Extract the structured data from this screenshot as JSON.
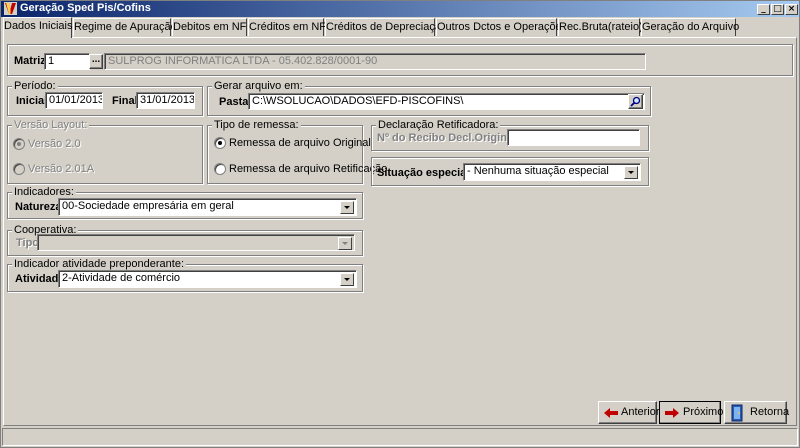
{
  "window": {
    "title": "Geração Sped Pis/Cofins",
    "controls": {
      "minimize": "_",
      "maximize": "□",
      "close": "×"
    }
  },
  "tabs": [
    "Dados Iniciais",
    "Regime de Apuração",
    "Debitos em NF",
    "Créditos em NF",
    "Créditos de Depreciação",
    "Outros Dctos e Operações",
    "Rec.Bruta(rateio)",
    "Geração do Arquivo"
  ],
  "matriz": {
    "label": "Matriz",
    "value": "1",
    "lookup_label": "...",
    "company": "SULPROG INFORMATICA LTDA - 05.402.828/0001-90"
  },
  "periodo": {
    "legend": "Período:",
    "inicial_label": "Inicial",
    "inicial_value": "01/01/2013",
    "final_label": "Final",
    "final_value": "31/01/2013"
  },
  "gerar": {
    "legend": "Gerar arquivo em:",
    "pasta_label": "Pasta",
    "pasta_value": "C:\\WSOLUCAO\\DADOS\\EFD-PISCOFINS\\"
  },
  "versao": {
    "legend": "Versão Layout:",
    "options": [
      "Versão 2.0",
      "Versão 2.01A"
    ]
  },
  "remessa": {
    "legend": "Tipo de remessa:",
    "options": [
      "Remessa de arquivo Original",
      "Remessa de arquivo Retificação"
    ]
  },
  "retificadora": {
    "legend": "Declaração Retificadora:",
    "recibo_label": "Nº do Recibo Decl.Original:",
    "recibo_value": ""
  },
  "situacao": {
    "label": "Situação especial",
    "value": "- Nenhuma situação especial"
  },
  "indicadores": {
    "legend": "Indicadores:",
    "natureza_label": "Natureza",
    "natureza_value": "00-Sociedade empresária em geral"
  },
  "cooperativa": {
    "legend": "Cooperativa:",
    "tipo_label": "Tipo",
    "tipo_value": ""
  },
  "atividade": {
    "legend": "Indicador atividade preponderante:",
    "label": "Atividade",
    "value": "2-Atividade de comércio"
  },
  "buttons": {
    "anterior": "Anterior",
    "proximo": "Próximo",
    "retorna": "Retorna"
  },
  "colors": {
    "titlebar_start": "#0a246a",
    "titlebar_end": "#a6caf0",
    "face": "#d4d0c8",
    "arrow_red": "#c00000"
  }
}
